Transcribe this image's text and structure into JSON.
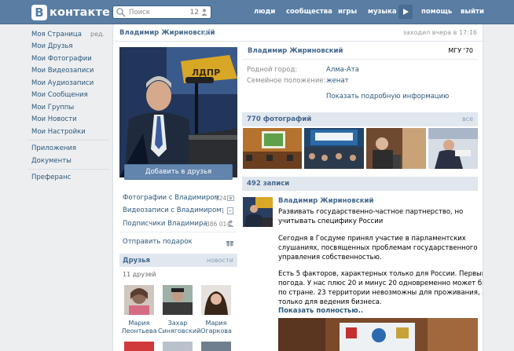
{
  "header": {
    "logo_letter": "В",
    "logo_text": "контакте",
    "search_placeholder": "Поиск",
    "search_count": "12",
    "nav": [
      "люди",
      "сообщества",
      "игры",
      "музыка",
      "помощь",
      "выйти"
    ],
    "brand_color": "#597da3"
  },
  "leftmenu": {
    "edit": "ред.",
    "group1": [
      "Моя Страница",
      "Мои Друзья",
      "Мои Фотографии",
      "Мои Видеозаписи",
      "Мои Аудиозаписи",
      "Мои Сообщения",
      "Мои Группы",
      "Мои Новости",
      "Мои Настройки"
    ],
    "group2": [
      "Приложения",
      "Документы"
    ],
    "group3": [
      "Преферанс"
    ]
  },
  "page": {
    "top_name": "Владимир Жириновский",
    "last_seen": "заходил вчера в 17:16"
  },
  "profile": {
    "name": "Владимир Жириновский",
    "university": "МГУ '70",
    "fields": [
      {
        "label": "Родной город:",
        "value": "Алма-Ата"
      },
      {
        "label": "Семейное положение:",
        "value": "женат"
      }
    ],
    "more_info": "Показать подробную информацию"
  },
  "actions": {
    "add_friend": "Добавить в друзья",
    "links": [
      {
        "label": "Фотографии с Владимиром",
        "count": "124"
      },
      {
        "label": "Видеозаписи с Владимиром",
        "count": "1"
      },
      {
        "label": "Подписчики Владимира",
        "count": "386 014"
      }
    ],
    "gift": "Отправить подарок"
  },
  "friends": {
    "title": "Друзья",
    "recent": "новости",
    "count": "11 друзей",
    "list": [
      {
        "first": "Мария",
        "last": "Леонтьева"
      },
      {
        "first": "Захар",
        "last": "Синяговский"
      },
      {
        "first": "Мария",
        "last": "Огаркова"
      }
    ]
  },
  "photos": {
    "title": "770 фотографий",
    "all": "все"
  },
  "wall": {
    "title": "492 записи",
    "author": "Владимир Жириновский",
    "lines": [
      "Развивать государственно-частное партнерство, но",
      "учитывать специфику России",
      "",
      "Сегодня в Госдуме принял участие в парламентских",
      "слушаниях, посвященных проблемам государственного",
      "управления собственностью.",
      "",
      "Есть 5 факторов, характерных только для России. Первый -",
      "погода. У нас плюс 20 и минус 20 одновременно может быть",
      "по стране. 23 территории невозможны для проживания, а не",
      "только для ведения бизнеса."
    ],
    "show_more": "Показать полностью.."
  }
}
